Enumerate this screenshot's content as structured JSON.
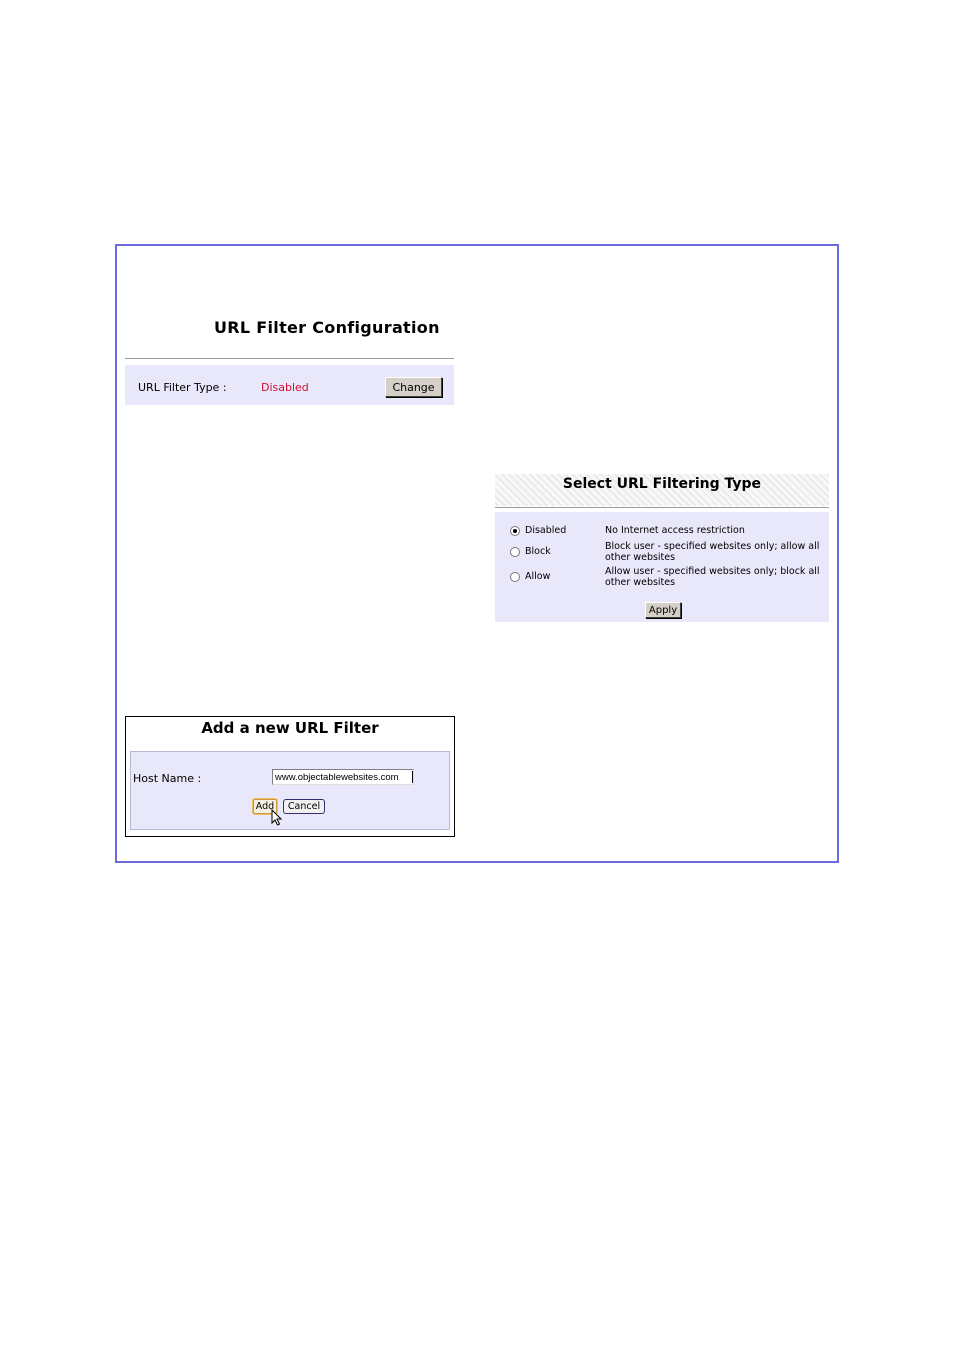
{
  "url_filter_config": {
    "title": "URL Filter Configuration",
    "filter_type_label": "URL Filter Type :",
    "filter_type_value": "Disabled",
    "change_button": "Change",
    "value_color": "#d01030"
  },
  "select_filtering_type": {
    "title": "Select URL Filtering Type",
    "options": [
      {
        "label": "Disabled",
        "description": "No Internet access restriction",
        "selected": true
      },
      {
        "label": "Block",
        "description": "Block user - specified websites only; allow all other websites",
        "selected": false
      },
      {
        "label": "Allow",
        "description": "Allow user - specified websites only; block all other websites",
        "selected": false
      }
    ],
    "apply_button": "Apply"
  },
  "add_url_filter": {
    "title": "Add a new URL Filter",
    "host_name_label": "Host Name :",
    "host_name_value": "www.objectablewebsites.com",
    "add_button": "Add",
    "cancel_button": "Cancel"
  },
  "icons": {
    "cursor": "arrow-pointer-icon",
    "radio": "radio-button-icon"
  },
  "colors": {
    "frame_border": "#6b6bdc",
    "panel_background": "#e8e8fa"
  }
}
